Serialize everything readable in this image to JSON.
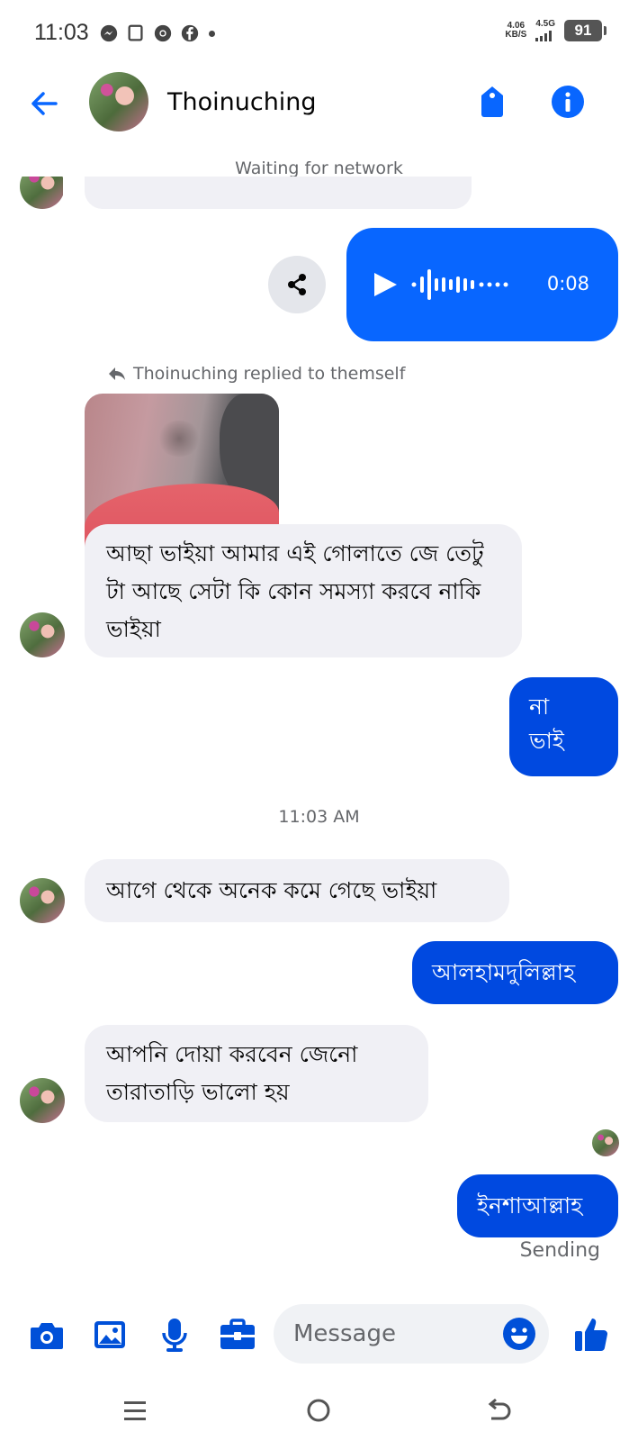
{
  "status_bar": {
    "time": "11:03",
    "speed_value": "4.06",
    "speed_unit": "KB/S",
    "network_type": "4.5G",
    "battery": "91",
    "icons": [
      "messenger-icon",
      "screen-icon",
      "chrome-icon",
      "facebook-icon"
    ]
  },
  "header": {
    "title": "Thoinuching"
  },
  "network_status": "Waiting for network",
  "voice_message": {
    "duration": "0:08"
  },
  "reply_note": "Thoinuching replied to themself",
  "messages": {
    "in_1": "আছা ভাইয়া আমার এই গোলাতে জে তেটু টা আছে  সেটা কি কোন সমস্যা করবে নাকি ভাইয়া",
    "out_1_line1": "না",
    "out_1_line2": "ভাই",
    "timestamp": "11:03 AM",
    "in_2": "আগে থেকে অনেক কমে গেছে ভাইয়া",
    "out_2": "আলহামদুলিল্লাহ",
    "in_3": "আপনি দোয়া করবেন  জেনো তারাতাড়ি ভালো হয়",
    "out_3": "ইনশাআল্লাহ",
    "delivery_status": "Sending"
  },
  "composer": {
    "placeholder": "Message"
  },
  "colors": {
    "accent": "#0866ff",
    "outgoing_bubble": "#0049e0",
    "incoming_bubble": "#f0f0f5",
    "icon_blue": "#0050d8"
  }
}
